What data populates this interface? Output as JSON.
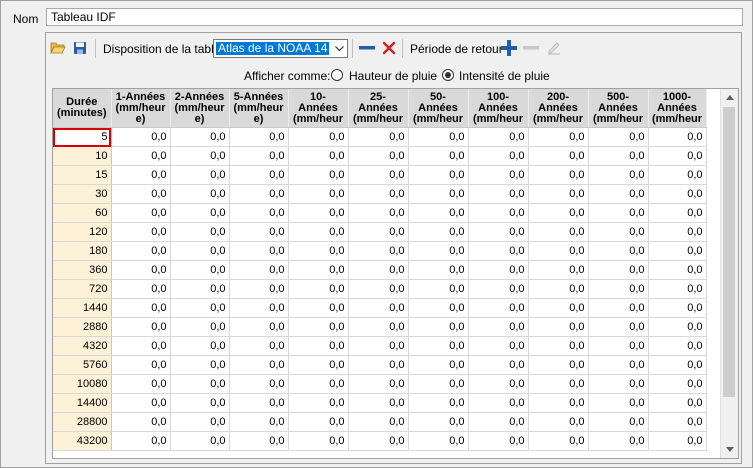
{
  "form": {
    "nom_label": "Nom",
    "nom_value": "Tableau IDF"
  },
  "toolbar": {
    "open_icon": "folder-open-icon",
    "save_icon": "floppy-disk-icon",
    "disposition_label": "Disposition de la table",
    "disposition_value": "Atlas de la NOAA 14",
    "periode_label": "Période de retour"
  },
  "display": {
    "label": "Afficher comme:",
    "option_depth": "Hauteur de pluie",
    "option_intensity": "Intensité de pluie",
    "selected": "Intensité de pluie"
  },
  "table": {
    "headers": [
      [
        "Durée",
        "(minutes)"
      ],
      [
        "1-Années",
        "(mm/heur",
        "e)"
      ],
      [
        "2-Années",
        "(mm/heur",
        "e)"
      ],
      [
        "5-Années",
        "(mm/heur",
        "e)"
      ],
      [
        "10-",
        "Années",
        "(mm/heur"
      ],
      [
        "25-",
        "Années",
        "(mm/heur"
      ],
      [
        "50-",
        "Années",
        "(mm/heur"
      ],
      [
        "100-",
        "Années",
        "(mm/heur"
      ],
      [
        "200-",
        "Années",
        "(mm/heur"
      ],
      [
        "500-",
        "Années",
        "(mm/heur"
      ],
      [
        "1000-",
        "Années",
        "(mm/heur"
      ]
    ],
    "durations": [
      "5",
      "10",
      "15",
      "30",
      "60",
      "120",
      "180",
      "360",
      "720",
      "1440",
      "2880",
      "4320",
      "5760",
      "10080",
      "14400",
      "28800",
      "43200"
    ],
    "cell_value": "0,0"
  },
  "colors": {
    "accent": "#0078d7",
    "duration_bg": "#fdf1d8",
    "selection_border": "#d80000",
    "header_bg": "#d9d9d9",
    "add_blue": "#1f5fa8",
    "delete_red": "#d42020"
  }
}
